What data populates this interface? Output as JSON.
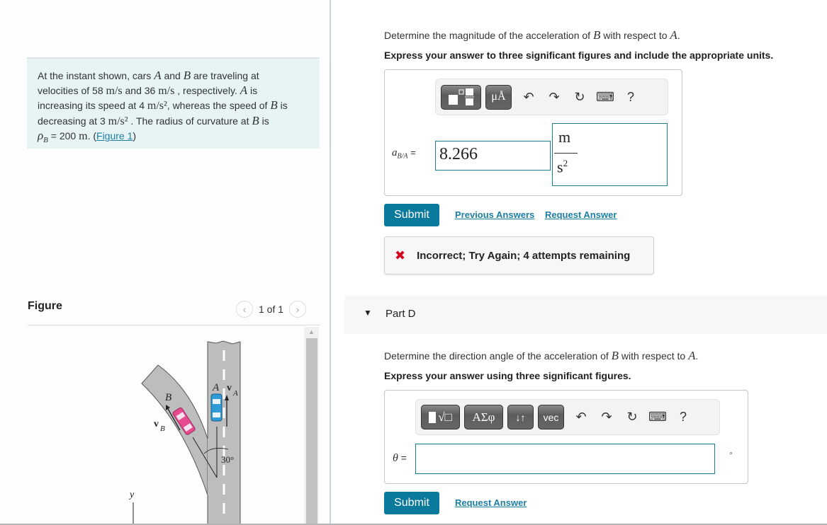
{
  "problem": {
    "line1_pre": "At the instant shown, cars ",
    "carA": "A",
    "and": " and ",
    "carB": "B",
    "line1_post": " are traveling at",
    "line2_pre": "velocities of 58 ",
    "unit_ms": "m/s",
    "line2_mid": " and 36 ",
    "line2_post": " , respectively. ",
    "is": " is",
    "line3_pre": "increasing its speed at 4 ",
    "unit_ms2": "m/s²",
    "line3_post": ", whereas the speed of ",
    "line4_pre": "decreasing at 3 ",
    "line4_post": " . The radius of curvature at ",
    "rho": "ρ",
    "rho_sub": "B",
    "line5_post": " = 200 ",
    "unit_m": "m",
    "period": ". (",
    "figure_link": "Figure 1",
    "close": ")"
  },
  "figure": {
    "title": "Figure",
    "pager": "1 of 1",
    "prev_icon": "‹",
    "next_icon": "›",
    "labels": {
      "A": "A",
      "vA": "v",
      "vA_sub": "A",
      "B": "B",
      "vB": "v",
      "vB_sub": "B",
      "angle": "30°",
      "y_axis": "y"
    },
    "colors": {
      "road": "#bdbdbd",
      "carA": "#2f9bd6",
      "carB": "#e64b8f"
    }
  },
  "partC": {
    "question_pre": "Determine the magnitude of the acceleration of ",
    "B": "B",
    "question_mid": " with respect to ",
    "A": "A",
    "question_post": ".",
    "instruction": "Express your answer to three significant figures and include the appropriate units.",
    "toolbar": {
      "template_icon": "fraction-template",
      "units_label": "μÅ",
      "undo": "undo-icon",
      "redo": "redo-icon",
      "reset": "reset-icon",
      "keyboard": "keyboard-icon",
      "help": "?"
    },
    "var_label": "a",
    "var_sub": "B/A",
    "equals": "=",
    "value": "8.266",
    "unit_num": "m",
    "unit_den": "s",
    "unit_exp": "2",
    "submit_label": "Submit",
    "previous_answers_label": "Previous Answers",
    "request_answer_label": "Request Answer",
    "feedback_icon": "✖",
    "feedback_text": "Incorrect; Try Again; 4 attempts remaining"
  },
  "partD": {
    "title": "Part D",
    "toggle_icon": "▼",
    "question_pre": "Determine the direction angle of the acceleration of ",
    "B": "B",
    "question_mid": " with respect to ",
    "A": "A",
    "question_post": ".",
    "instruction": "Express your answer using three significant figures.",
    "toolbar": {
      "template_label": "√□",
      "greek_label": "ΑΣφ",
      "arrows_label": "↓↑",
      "vec_label": "vec",
      "undo": "undo-icon",
      "redo": "redo-icon",
      "reset": "reset-icon",
      "keyboard": "keyboard-icon",
      "help": "?"
    },
    "var_label": "θ",
    "equals": "=",
    "value": "",
    "unit": "°",
    "submit_label": "Submit",
    "request_answer_label": "Request Answer"
  },
  "colors": {
    "accent": "#0a7a9c",
    "link": "#1b7ea3",
    "error": "#d0021b",
    "input_border": "#1d7b94"
  }
}
